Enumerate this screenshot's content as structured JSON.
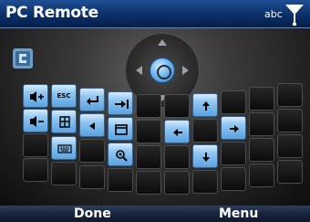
{
  "title_bar": {
    "title": "PC Remote",
    "input_mode": "abc",
    "signal_icon": "signal-strength-icon"
  },
  "keypad": {
    "app_icon": "pc-remote-app-icon",
    "dpad": {
      "buttons": [
        "up",
        "down",
        "left",
        "right",
        "select"
      ]
    },
    "keys": [
      {
        "name": "volume-up-key",
        "icon": "volume-up-icon"
      },
      {
        "name": "escape-key",
        "label": "ESC"
      },
      {
        "name": "enter-key",
        "icon": "enter-arrow-icon"
      },
      {
        "name": "tab-key",
        "icon": "tab-arrow-icon"
      },
      {
        "name": "arrow-up-key",
        "icon": "arrow-up-icon"
      },
      {
        "name": "volume-down-key",
        "icon": "volume-down-icon"
      },
      {
        "name": "start-menu-key",
        "icon": "windows-start-icon"
      },
      {
        "name": "backspace-key",
        "icon": "backspace-icon"
      },
      {
        "name": "windows-key",
        "icon": "window-icon"
      },
      {
        "name": "arrow-left-key",
        "icon": "arrow-left-icon"
      },
      {
        "name": "arrow-right-key",
        "icon": "arrow-right-icon"
      },
      {
        "name": "keyboard-key",
        "icon": "keyboard-icon"
      },
      {
        "name": "zoom-key",
        "icon": "magnifier-icon"
      },
      {
        "name": "arrow-down-key",
        "icon": "arrow-down-icon"
      }
    ]
  },
  "softkeys": {
    "left": "Done",
    "right": "Menu"
  },
  "colors": {
    "title_bar": "#0b2f66",
    "active_key": "#92c6f0",
    "inactive_key": "#1a1a1a",
    "softkey_bar": "#18253c"
  }
}
